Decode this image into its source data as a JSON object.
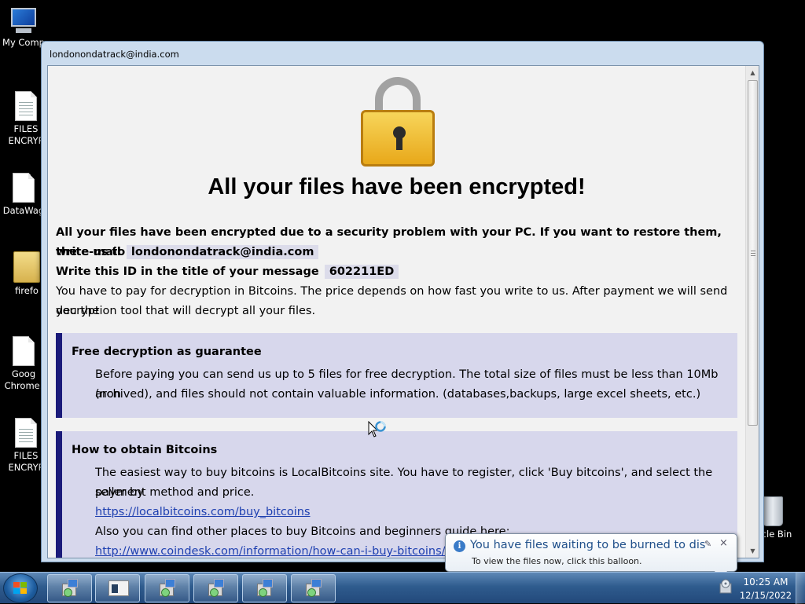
{
  "desktop": {
    "icons": [
      {
        "label": "My Comp"
      },
      {
        "label": "FILES ENCRYP"
      },
      {
        "label": "DataWag"
      },
      {
        "label": "firefo"
      },
      {
        "label": "Goog Chrome."
      },
      {
        "label": "FILES ENCRYP"
      },
      {
        "label": "cle Bin"
      }
    ]
  },
  "window": {
    "title": "londonondatrack@india.com"
  },
  "ransom_note": {
    "headline": "All your files have been encrypted!",
    "intro_line1": "All your files have been encrypted due to a security problem with your PC. If you want to restore them, write us to",
    "intro_line2_prefix": "the e-mail",
    "email": "londonondatrack@india.com",
    "id_prefix": "Write this ID in the title of your message",
    "id": "602211ED",
    "payment_text": "You have to pay for decryption in Bitcoins. The price depends on how fast you write to us. After payment we will send you the",
    "payment_text2": "decryption tool that will decrypt all your files.",
    "guarantee": {
      "title": "Free decryption as guarantee",
      "line1": "Before paying you can send us up to 5 files for free decryption. The total size of files must be less than 10Mb (non",
      "line2": "archived), and files should not contain valuable information. (databases,backups, large excel sheets, etc.)"
    },
    "bitcoins": {
      "title": "How to obtain Bitcoins",
      "line1": "The easiest way to buy bitcoins is LocalBitcoins site. You have to register, click 'Buy bitcoins', and select the seller by",
      "line2": "payment method and price.",
      "link1": "https://localbitcoins.com/buy_bitcoins",
      "line3": "Also you can find other places to buy Bitcoins and beginners guide here:",
      "link2": "http://www.coindesk.com/information/how-can-i-buy-bitcoins/"
    }
  },
  "balloon": {
    "title": "You have files waiting to be burned to disc",
    "text": "To view the files now, click this balloon.",
    "close_glyph": "×",
    "options_glyph": "✎"
  },
  "taskbar": {
    "buttons": [
      {
        "icon": "installer-icon"
      },
      {
        "icon": "window-icon"
      },
      {
        "icon": "installer-icon"
      },
      {
        "icon": "installer-icon"
      },
      {
        "icon": "installer-icon"
      },
      {
        "icon": "installer-icon"
      }
    ],
    "clock_time": "10:25 AM",
    "clock_date": "12/15/2022"
  },
  "colors": {
    "box_background": "#d7d7ec",
    "box_accent": "#1b1b7a",
    "link": "#1d3fb0",
    "lock_gold": "#f0b52a"
  }
}
